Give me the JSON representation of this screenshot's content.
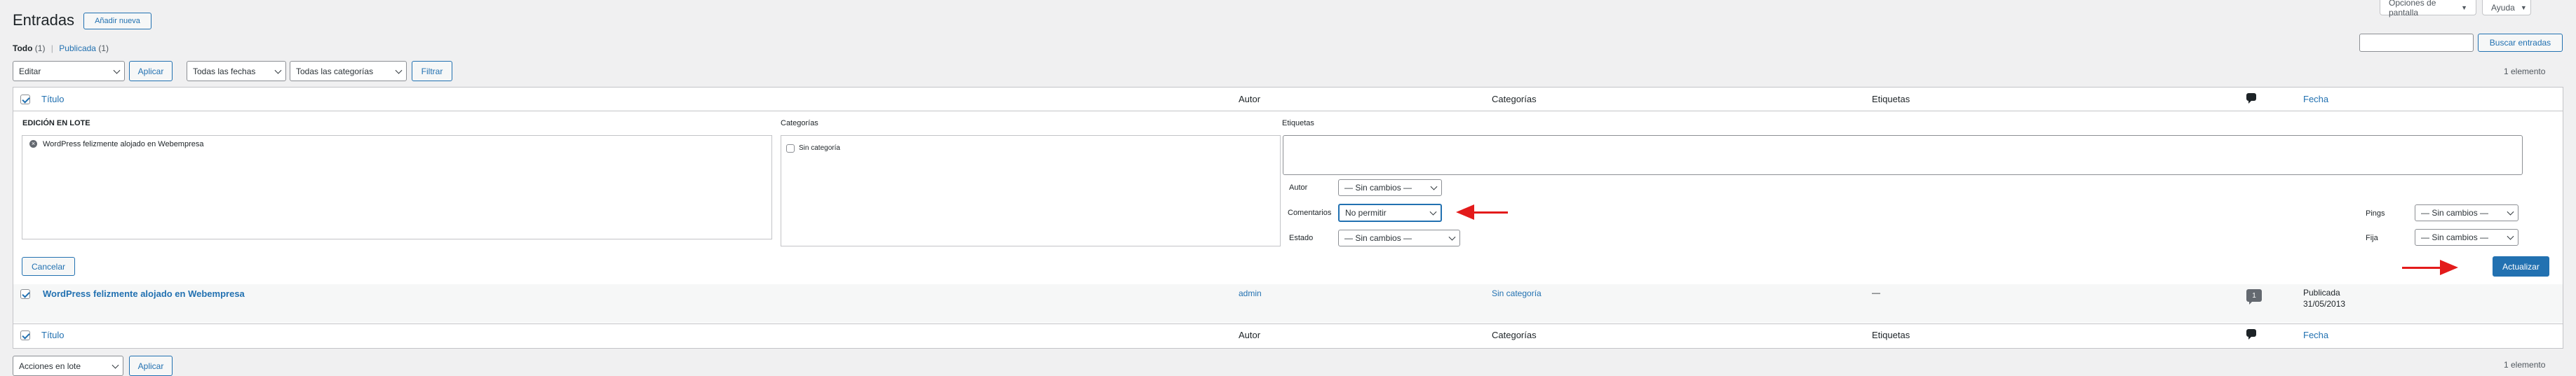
{
  "screen_tabs": {
    "options": "Opciones de pantalla",
    "help": "Ayuda"
  },
  "header": {
    "title": "Entradas",
    "add_new": "Añadir nueva"
  },
  "subsubsub": {
    "all": "Todo",
    "all_count": "(1)",
    "sep": "|",
    "published": "Publicada",
    "published_count": "(1)"
  },
  "search": {
    "value": "",
    "button": "Buscar entradas"
  },
  "filters": {
    "bulk_action": "Editar",
    "apply": "Aplicar",
    "dates": "Todas las fechas",
    "categories": "Todas las categorías",
    "filter": "Filtrar",
    "item_count": "1 elemento"
  },
  "table_header": {
    "title": "Título",
    "author": "Autor",
    "categories": "Categorías",
    "tags": "Etiquetas",
    "date": "Fecha"
  },
  "bulk_edit": {
    "heading": "EDICIÓN EN LOTE",
    "post_item": "WordPress felizmente alojado en Webempresa",
    "categories_label": "Categorías",
    "category_option": "Sin categoría",
    "tags_label": "Etiquetas",
    "author_label": "Autor",
    "author_value": "— Sin cambios —",
    "comments_label": "Comentarios",
    "comments_value": "No permitir",
    "status_label": "Estado",
    "status_value": "— Sin cambios —",
    "pings_label": "Pings",
    "pings_value": "— Sin cambios —",
    "sticky_label": "Fija",
    "sticky_value": "— Sin cambios —",
    "cancel": "Cancelar",
    "update": "Actualizar"
  },
  "rows": [
    {
      "title": "WordPress felizmente alojado en Webempresa",
      "author": "admin",
      "category": "Sin categoría",
      "tags": "—",
      "comments": "1",
      "date_status": "Publicada",
      "date": "31/05/2013"
    }
  ],
  "bottom_bar": {
    "bulk_action": "Acciones en lote",
    "apply": "Aplicar",
    "item_count": "1 elemento"
  },
  "colors": {
    "accent": "#2271b1",
    "annotation_arrow": "#e31b1b"
  },
  "icons": [
    "comment-bubble-icon",
    "checkbox-icon",
    "chevron-down-icon",
    "remove-item-icon",
    "red-arrow-icon"
  ]
}
